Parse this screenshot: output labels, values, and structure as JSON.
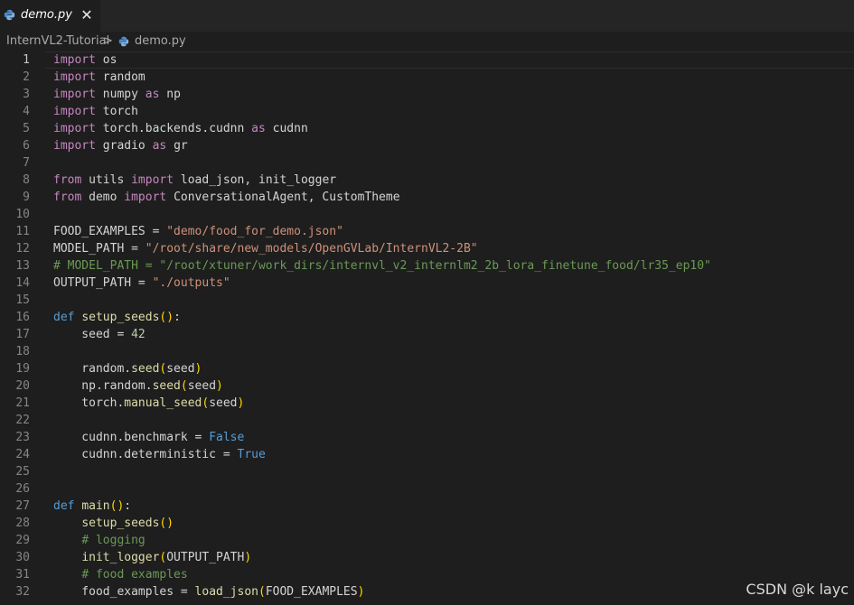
{
  "tab": {
    "title": "demo.py",
    "close_glyph": "✕",
    "icon": "python-file-icon"
  },
  "breadcrumb": {
    "folder": "InternVL2-Tutorial",
    "separator": ">",
    "file": "demo.py",
    "file_icon": "python-file-icon"
  },
  "editor": {
    "current_line": 1,
    "lines": [
      [
        [
          "kw",
          "import"
        ],
        [
          "var",
          " os"
        ]
      ],
      [
        [
          "kw",
          "import"
        ],
        [
          "var",
          " random"
        ]
      ],
      [
        [
          "kw",
          "import"
        ],
        [
          "var",
          " numpy "
        ],
        [
          "kw",
          "as"
        ],
        [
          "var",
          " np"
        ]
      ],
      [
        [
          "kw",
          "import"
        ],
        [
          "var",
          " torch"
        ]
      ],
      [
        [
          "kw",
          "import"
        ],
        [
          "var",
          " torch.backends.cudnn "
        ],
        [
          "kw",
          "as"
        ],
        [
          "var",
          " cudnn"
        ]
      ],
      [
        [
          "kw",
          "import"
        ],
        [
          "var",
          " gradio "
        ],
        [
          "kw",
          "as"
        ],
        [
          "var",
          " gr"
        ]
      ],
      [],
      [
        [
          "kw",
          "from"
        ],
        [
          "var",
          " utils "
        ],
        [
          "kw",
          "import"
        ],
        [
          "var",
          " load_json, init_logger"
        ]
      ],
      [
        [
          "kw",
          "from"
        ],
        [
          "var",
          " demo "
        ],
        [
          "kw",
          "import"
        ],
        [
          "var",
          " ConversationalAgent, CustomTheme"
        ]
      ],
      [],
      [
        [
          "var",
          "FOOD_EXAMPLES = "
        ],
        [
          "str",
          "\"demo/food_for_demo.json\""
        ]
      ],
      [
        [
          "var",
          "MODEL_PATH = "
        ],
        [
          "str",
          "\"/root/share/new_models/OpenGVLab/InternVL2-2B\""
        ]
      ],
      [
        [
          "cm",
          "# MODEL_PATH = \"/root/xtuner/work_dirs/internvl_v2_internlm2_2b_lora_finetune_food/lr35_ep10\""
        ]
      ],
      [
        [
          "var",
          "OUTPUT_PATH = "
        ],
        [
          "str",
          "\"./outputs\""
        ]
      ],
      [],
      [
        [
          "def",
          "def"
        ],
        [
          "var",
          " "
        ],
        [
          "fn",
          "setup_seeds"
        ],
        [
          "br1",
          "()"
        ],
        [
          "var",
          ":"
        ]
      ],
      [
        [
          "var",
          "    seed = "
        ],
        [
          "num",
          "42"
        ]
      ],
      [],
      [
        [
          "var",
          "    random."
        ],
        [
          "fn",
          "seed"
        ],
        [
          "br1",
          "("
        ],
        [
          "var",
          "seed"
        ],
        [
          "br1",
          ")"
        ]
      ],
      [
        [
          "var",
          "    np.random."
        ],
        [
          "fn",
          "seed"
        ],
        [
          "br1",
          "("
        ],
        [
          "var",
          "seed"
        ],
        [
          "br1",
          ")"
        ]
      ],
      [
        [
          "var",
          "    torch."
        ],
        [
          "fn",
          "manual_seed"
        ],
        [
          "br1",
          "("
        ],
        [
          "var",
          "seed"
        ],
        [
          "br1",
          ")"
        ]
      ],
      [],
      [
        [
          "var",
          "    cudnn.benchmark = "
        ],
        [
          "const",
          "False"
        ]
      ],
      [
        [
          "var",
          "    cudnn.deterministic = "
        ],
        [
          "const",
          "True"
        ]
      ],
      [],
      [],
      [
        [
          "def",
          "def"
        ],
        [
          "var",
          " "
        ],
        [
          "fn",
          "main"
        ],
        [
          "br1",
          "()"
        ],
        [
          "var",
          ":"
        ]
      ],
      [
        [
          "var",
          "    "
        ],
        [
          "fn",
          "setup_seeds"
        ],
        [
          "br1",
          "()"
        ]
      ],
      [
        [
          "var",
          "    "
        ],
        [
          "cm",
          "# logging"
        ]
      ],
      [
        [
          "var",
          "    "
        ],
        [
          "fn",
          "init_logger"
        ],
        [
          "br1",
          "("
        ],
        [
          "var",
          "OUTPUT_PATH"
        ],
        [
          "br1",
          ")"
        ]
      ],
      [
        [
          "var",
          "    "
        ],
        [
          "cm",
          "# food examples"
        ]
      ],
      [
        [
          "var",
          "    food_examples = "
        ],
        [
          "fn",
          "load_json"
        ],
        [
          "br1",
          "("
        ],
        [
          "var",
          "FOOD_EXAMPLES"
        ],
        [
          "br1",
          ")"
        ]
      ]
    ]
  },
  "watermark": "CSDN @k layc",
  "colors": {
    "background": "#1e1e1e",
    "keyword": "#c586c0",
    "string": "#ce9178",
    "function": "#dcdcaa",
    "comment": "#6a9955"
  }
}
